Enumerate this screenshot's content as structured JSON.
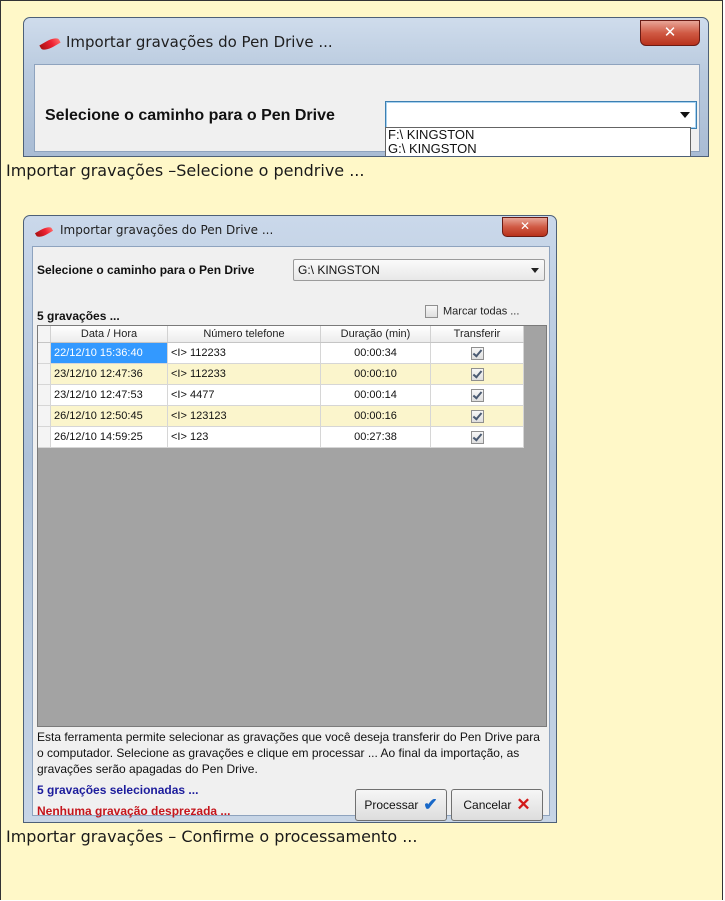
{
  "caption1": "Importar gravações –Selecione o pendrive ...",
  "caption2": "Importar gravações – Confirme o processamento ...",
  "shot1": {
    "window_title": "Importar gravações do Pen Drive ...",
    "close_glyph": "✕",
    "select_label": "Selecione o caminho para o Pen Drive",
    "combo_value": "",
    "dropdown_options": [
      "F:\\ KINGSTON",
      "G:\\ KINGSTON"
    ]
  },
  "shot2": {
    "window_title": "Importar gravações do Pen Drive ...",
    "close_glyph": "✕",
    "select_label": "Selecione o caminho para o Pen Drive",
    "combo_value": "G:\\ KINGSTON",
    "recordings_count": "5 gravações ...",
    "mark_all_label": "Marcar todas ...",
    "mark_all_checked": false,
    "columns": [
      "Data / Hora",
      "Número telefone",
      "Duração (min)",
      "Transferir"
    ],
    "rows": [
      {
        "date": "22/12/10 15:36:40",
        "number": "<I> 112233",
        "duration": "00:00:34",
        "transfer": true
      },
      {
        "date": "23/12/10 12:47:36",
        "number": "<I> 112233",
        "duration": "00:00:10",
        "transfer": true
      },
      {
        "date": "23/12/10 12:47:53",
        "number": "<I> 4477",
        "duration": "00:00:14",
        "transfer": true
      },
      {
        "date": "26/12/10 12:50:45",
        "number": "<I> 123123",
        "duration": "00:00:16",
        "transfer": true
      },
      {
        "date": "26/12/10 14:59:25",
        "number": "<I> 123",
        "duration": "00:27:38",
        "transfer": true
      }
    ],
    "info_text": "Esta ferramenta permite selecionar as gravações que você deseja transferir do Pen Drive para o computador. Selecione as gravações e clique em processar ... Ao final da importação, as gravações serão apagadas do Pen Drive.",
    "selected_text": "5 gravações selecionadas ...",
    "discarded_text": "Nenhuma gravação desprezada ...",
    "process_label": "Processar",
    "cancel_label": "Cancelar",
    "colors": {
      "selected_text": "#1c1c9c",
      "discarded_text": "#c4151c",
      "row_highlight": "#fbf5cc",
      "selection": "#3399ff"
    }
  }
}
